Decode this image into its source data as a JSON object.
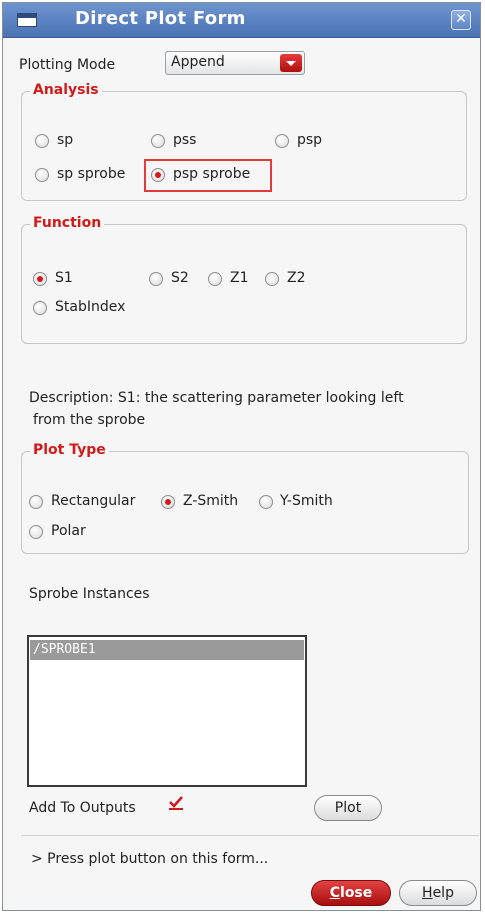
{
  "window": {
    "title": "Direct Plot Form",
    "close_glyph": "✕"
  },
  "plotting_mode": {
    "label": "Plotting Mode",
    "value": "Append"
  },
  "analysis": {
    "legend": "Analysis",
    "options": [
      "sp",
      "pss",
      "psp",
      "sp sprobe",
      "psp sprobe"
    ],
    "selected": "psp sprobe"
  },
  "function": {
    "legend": "Function",
    "options": [
      "S1",
      "S2",
      "Z1",
      "Z2",
      "StabIndex"
    ],
    "selected": "S1"
  },
  "description": {
    "line1": "Description: S1: the scattering parameter looking left",
    "line2": "from the sprobe"
  },
  "plot_type": {
    "legend": "Plot Type",
    "options": [
      "Rectangular",
      "Z-Smith",
      "Y-Smith",
      "Polar"
    ],
    "selected": "Z-Smith"
  },
  "sprobe_instances": {
    "label": "Sprobe Instances",
    "items": [
      "/SPROBE1"
    ]
  },
  "add_to_outputs": {
    "label": "Add To Outputs",
    "checked": true
  },
  "buttons": {
    "plot": "Plot",
    "close_first": "C",
    "close_rest": "lose",
    "help_first": "H",
    "help_rest": "elp"
  },
  "status": "> Press plot button on this form...",
  "colors": {
    "accent_red": "#d11a1a",
    "title_blue": "#5a80c0"
  }
}
